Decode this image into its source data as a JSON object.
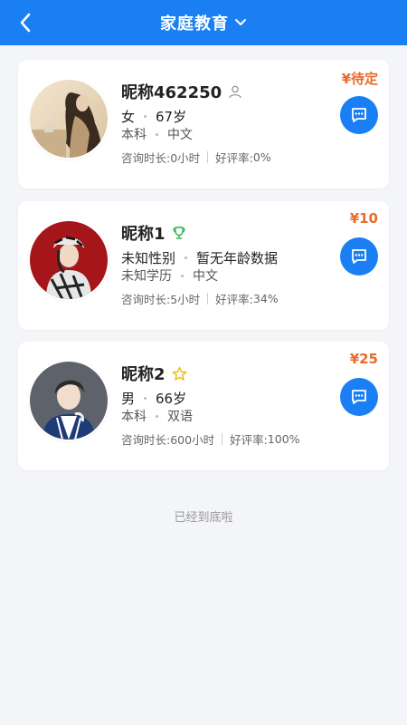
{
  "header": {
    "title": "家庭教育",
    "bg_color": "#1a7ff2",
    "back_icon": "chevron-left-icon",
    "dropdown_icon": "chevron-down-icon"
  },
  "cards": [
    {
      "name": "昵称462250",
      "badge_icon": "person-outline-icon",
      "gender": "女",
      "age": "67岁",
      "education": "本科",
      "language": "中文",
      "duration_label": "咨询时长:",
      "duration_value": "0小时",
      "rating_label": "好评率:",
      "rating_value": "0%",
      "price": "¥待定",
      "chat_icon": "chat-bubble-icon"
    },
    {
      "name": "昵称1",
      "badge_icon": "trophy-icon",
      "gender": "未知性别",
      "age": "暂无年龄数据",
      "education": "未知学历",
      "language": "中文",
      "duration_label": "咨询时长:",
      "duration_value": "5小时",
      "rating_label": "好评率:",
      "rating_value": "34%",
      "price": "¥10",
      "chat_icon": "chat-bubble-icon"
    },
    {
      "name": "昵称2",
      "badge_icon": "star-outline-icon",
      "gender": "男",
      "age": "66岁",
      "education": "本科",
      "language": "双语",
      "duration_label": "咨询时长:",
      "duration_value": "600小时",
      "rating_label": "好评率:",
      "rating_value": "100%",
      "price": "¥25",
      "chat_icon": "chat-bubble-icon"
    }
  ],
  "footer": {
    "text": "已经到底啦"
  },
  "colors": {
    "accent": "#1a7ff2",
    "price": "#e86a2c",
    "background": "#f4f5f8"
  }
}
